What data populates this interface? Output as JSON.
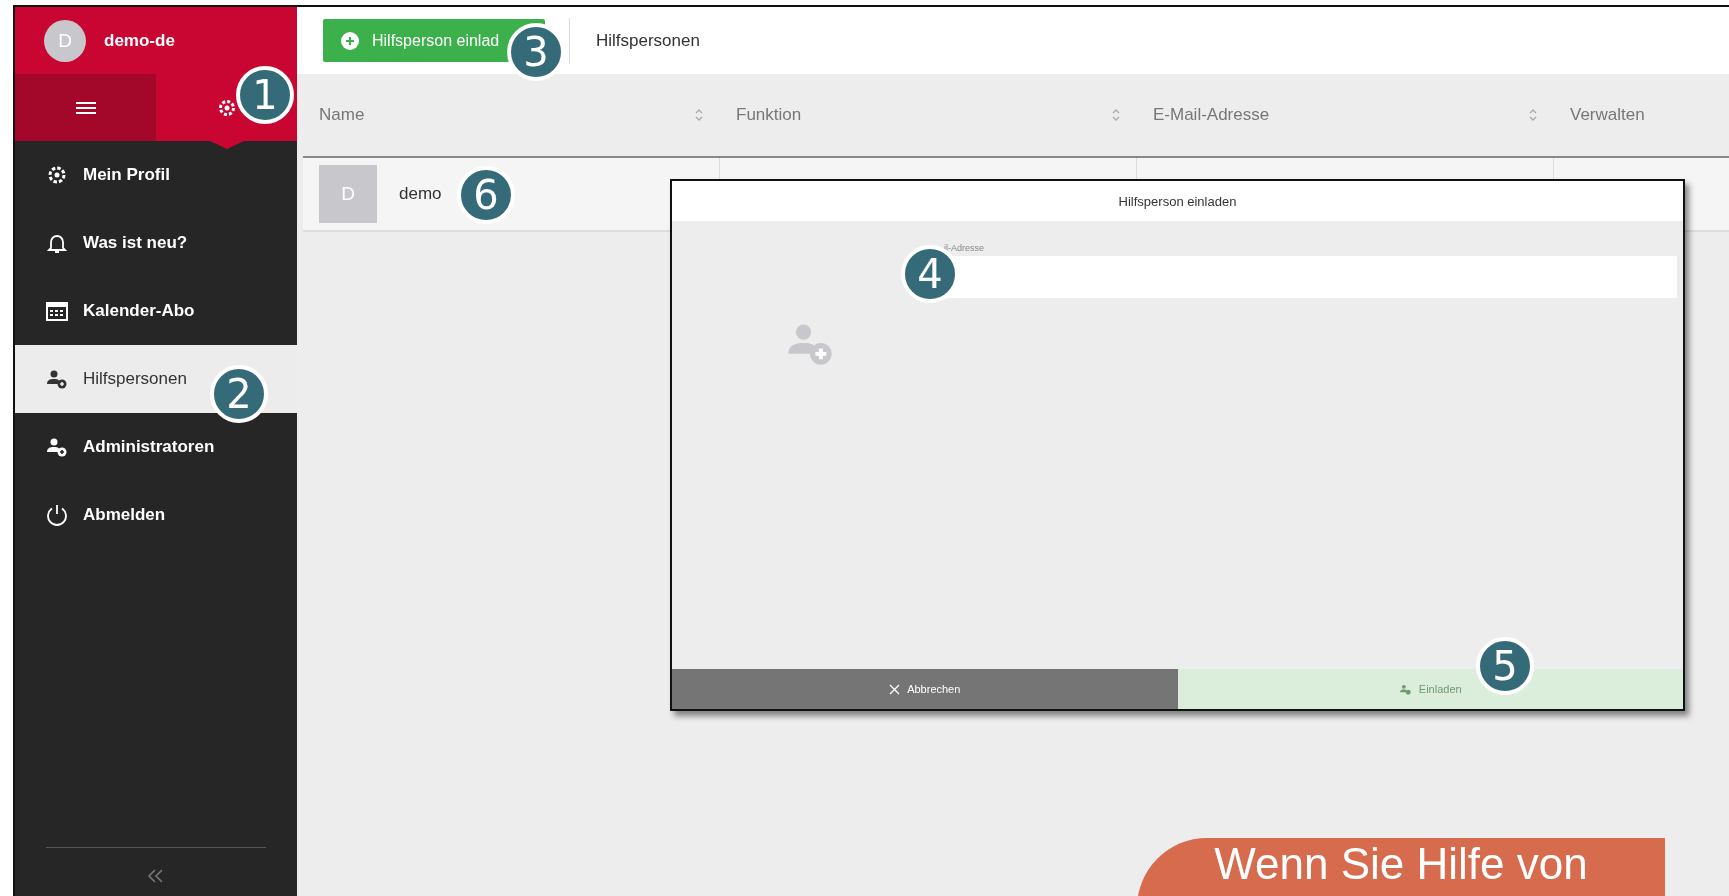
{
  "sidebar": {
    "user": {
      "avatar": "D",
      "name": "demo-de"
    },
    "tabs": [
      {
        "selected": false
      },
      {
        "selected": true
      }
    ],
    "items": [
      {
        "label": "Mein Profil",
        "selected": false
      },
      {
        "label": "Was ist neu?",
        "selected": false
      },
      {
        "label": "Kalender-Abo",
        "selected": false
      },
      {
        "label": "Hilfspersonen",
        "selected": true
      },
      {
        "label": "Administratoren",
        "selected": false
      },
      {
        "label": "Abmelden",
        "selected": false
      }
    ]
  },
  "toolbar": {
    "invite_button": "Hilfsperson einlad",
    "title": "Hilfspersonen"
  },
  "table": {
    "columns": [
      "Name",
      "Funktion",
      "E-Mail-Adresse",
      "Verwalten"
    ],
    "rows": [
      {
        "avatar": "D",
        "name": "demo"
      }
    ]
  },
  "dialog": {
    "title": "Hilfsperson einladen",
    "field_label": "il-Adresse",
    "cancel": "Abbrechen",
    "submit": "Einladen",
    "submit_disabled": true
  },
  "banner": "Wenn Sie Hilfe von",
  "callouts": [
    "1",
    "2",
    "3",
    "4",
    "5",
    "6"
  ]
}
